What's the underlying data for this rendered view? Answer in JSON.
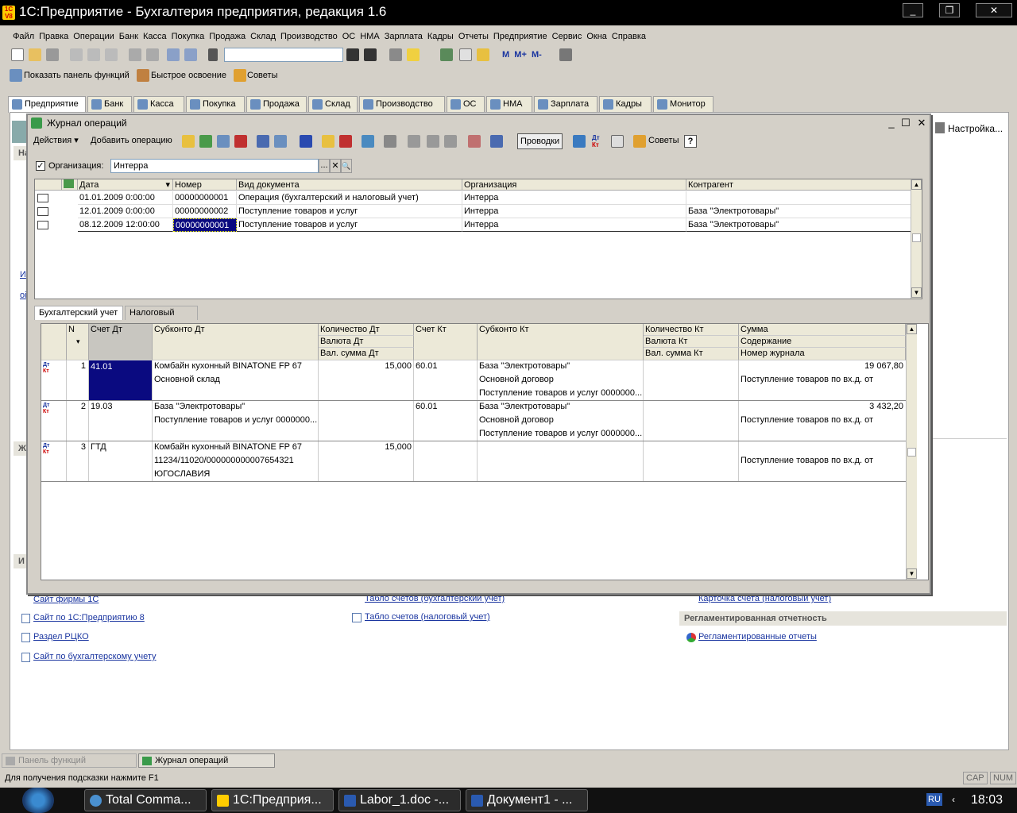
{
  "window": {
    "title": "1С:Предприятие - Бухгалтерия предприятия, редакция 1.6"
  },
  "menu": [
    "Файл",
    "Правка",
    "Операции",
    "Банк",
    "Касса",
    "Покупка",
    "Продажа",
    "Склад",
    "Производство",
    "ОС",
    "НМА",
    "Зарплата",
    "Кадры",
    "Отчеты",
    "Предприятие",
    "Сервис",
    "Окна",
    "Справка"
  ],
  "toolbar2": {
    "show_panel": "Показать панель функций",
    "quick": "Быстрое освоение",
    "tips": "Советы"
  },
  "top_tabs": [
    "Предприятие",
    "Банк",
    "Касса",
    "Покупка",
    "Продажа",
    "Склад",
    "Производство",
    "ОС",
    "НМА",
    "Зарплата",
    "Кадры",
    "Монитор"
  ],
  "workspace": {
    "settings": "Настройка...",
    "left_links": [
      "Сайт фирмы 1С",
      "Сайт по 1С:Предприятию 8",
      "Раздел РЦКО",
      "Сайт по бухгалтерскому учету"
    ],
    "mid_links": [
      "Табло счетов (бухгалтерский учет)",
      "Табло счетов (налоговый учет)"
    ],
    "right_link": "Карточка счета (налоговый учет)",
    "reg_header": "Регламентированная отчетность",
    "reg_link": "Регламентированные отчеты",
    "left_letters": [
      "На",
      "И",
      "оі",
      "Ж",
      "И"
    ]
  },
  "journal": {
    "title": "Журнал операций",
    "actions": "Действия",
    "add_op": "Добавить операцию",
    "postings": "Проводки",
    "tips": "Советы",
    "help": "?",
    "org_label": "Организация:",
    "org_value": "Интерра",
    "columns": [
      "Дата",
      "Номер",
      "Вид документа",
      "Организация",
      "Контрагент"
    ],
    "rows": [
      {
        "date": "01.01.2009 0:00:00",
        "num": "00000000001",
        "type": "Операция (бухгалтерский и налоговый учет)",
        "org": "Интерра",
        "counterparty": ""
      },
      {
        "date": "12.01.2009 0:00:00",
        "num": "00000000002",
        "type": "Поступление товаров и услуг",
        "org": "Интерра",
        "counterparty": "База \"Электротовары\""
      },
      {
        "date": "08.12.2009 12:00:00",
        "num": "00000000001",
        "type": "Поступление товаров и услуг",
        "org": "Интерра",
        "counterparty": "База \"Электротовары\""
      }
    ],
    "lower_tabs": [
      "Бухгалтерский учет",
      "Налоговый учет"
    ],
    "pcols": {
      "n": "N",
      "sort": "▾",
      "acct_dt": "Счет Дт",
      "sub_dt": "Субконто Дт",
      "qty_dt": "Количество Дт",
      "cur_dt": "Валюта Дт",
      "valsum_dt": "Вал. сумма Дт",
      "acct_kt": "Счет Кт",
      "sub_kt": "Субконто Кт",
      "qty_kt": "Количество Кт",
      "cur_kt": "Валюта Кт",
      "valsum_kt": "Вал. сумма Кт",
      "sum": "Сумма",
      "content": "Содержание",
      "journal_no": "Номер журнала"
    },
    "dt_kt": {
      "dt": "Дт",
      "kt": "Кт"
    },
    "postings_rows": [
      {
        "n": "1",
        "acct_dt": "41.01",
        "sub_dt": [
          "Комбайн кухонный BINATONE FP 67",
          "Основной склад",
          ""
        ],
        "qty_dt": "15,000",
        "acct_kt": "60.01",
        "sub_kt": [
          "База \"Электротовары\"",
          "Основной договор",
          "Поступление товаров и услуг 0000000..."
        ],
        "sum": "19 067,80",
        "content": "Поступление товаров по вх.д. от"
      },
      {
        "n": "2",
        "acct_dt": "19.03",
        "sub_dt": [
          "База \"Электротовары\"",
          "Поступление товаров и услуг 0000000...",
          ""
        ],
        "qty_dt": "",
        "acct_kt": "60.01",
        "sub_kt": [
          "База \"Электротовары\"",
          "Основной договор",
          "Поступление товаров и услуг 0000000..."
        ],
        "sum": "3 432,20",
        "content": "Поступление товаров по вх.д. от"
      },
      {
        "n": "3",
        "acct_dt": "ГТД",
        "sub_dt": [
          "Комбайн кухонный BINATONE FP 67",
          "11234/11020/000000000007654321",
          "ЮГОСЛАВИЯ"
        ],
        "qty_dt": "15,000",
        "acct_kt": "",
        "sub_kt": [
          "",
          "",
          ""
        ],
        "sum": "",
        "content": "Поступление товаров по вх.д. от"
      }
    ]
  },
  "bottom_tabs": [
    "Панель функций",
    "Журнал операций"
  ],
  "status": {
    "hint": "Для получения подсказки нажмите F1",
    "caps": "CAP",
    "num": "NUM"
  },
  "taskbar": {
    "items": [
      "Total Comma...",
      "1С:Предприя...",
      "Labor_1.doc -...",
      "Документ1 - ..."
    ],
    "lang": "RU",
    "time": "18:03"
  },
  "colors": {
    "selected": "#0a0a80",
    "link": "#1a35a0"
  }
}
